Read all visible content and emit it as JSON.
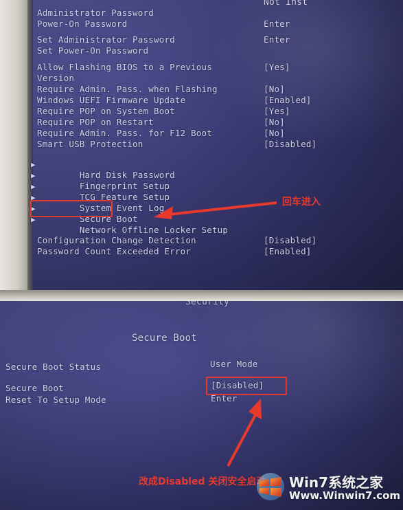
{
  "top_screen": {
    "partial_header": "Not Inst",
    "rows": [
      {
        "label": "Administrator Password",
        "value": "",
        "arrow": false
      },
      {
        "label": "Power-On Password",
        "value": "Enter",
        "arrow": false
      },
      {
        "label": "Set Administrator Password",
        "value": "Enter",
        "arrow": false
      },
      {
        "label": "Set Power-On Password",
        "value": "",
        "arrow": false
      },
      {
        "label": "Allow Flashing BIOS to a Previous",
        "value": "[Yes]",
        "arrow": false
      },
      {
        "label": "Version",
        "value": "",
        "arrow": false
      },
      {
        "label": "Require Admin. Pass. when Flashing",
        "value": "[No]",
        "arrow": false
      },
      {
        "label": "Windows UEFI Firmware Update",
        "value": "[Enabled]",
        "arrow": false
      },
      {
        "label": "Require POP on System Boot",
        "value": "[Yes]",
        "arrow": false
      },
      {
        "label": "Require POP on Restart",
        "value": "[No]",
        "arrow": false
      },
      {
        "label": "Require Admin. Pass. for F12 Boot",
        "value": "[No]",
        "arrow": false
      },
      {
        "label": "Smart USB Protection",
        "value": "[Disabled]",
        "arrow": false
      },
      {
        "label": "Hard Disk Password",
        "value": "",
        "arrow": true
      },
      {
        "label": "Fingerprint Setup",
        "value": "",
        "arrow": true
      },
      {
        "label": "TCG Feature Setup",
        "value": "",
        "arrow": true
      },
      {
        "label": "System Event Log",
        "value": "",
        "arrow": true
      },
      {
        "label": "Secure Boot",
        "value": "",
        "arrow": true
      },
      {
        "label": "Network Offline Locker Setup",
        "value": "",
        "arrow": true
      },
      {
        "label": "Configuration Change Detection",
        "value": "[Disabled]",
        "arrow": false
      },
      {
        "label": "Password Count Exceeded Error",
        "value": "[Enabled]",
        "arrow": false
      }
    ],
    "annotation": "回车进入",
    "highlighted_item": "Secure Boot"
  },
  "bottom_screen": {
    "partial_header": "Security",
    "title": "Secure Boot",
    "rows": [
      {
        "label": "Secure Boot Status",
        "value": "User Mode"
      },
      {
        "label": "Secure Boot",
        "value": "[Disabled]"
      },
      {
        "label": "Reset To Setup Mode",
        "value": "Enter"
      }
    ],
    "annotation": "改成Disabled 关闭安全启动",
    "highlighted_value": "[Disabled]"
  },
  "watermark": {
    "title": "Win7系统之家",
    "subtitle": "Www.Winwin7.com"
  },
  "colors": {
    "bios_background": "#3b3b78",
    "bios_text": "#cfd3ea",
    "annotation_red": "#e8392c",
    "selection_border": "#e33a2e"
  }
}
